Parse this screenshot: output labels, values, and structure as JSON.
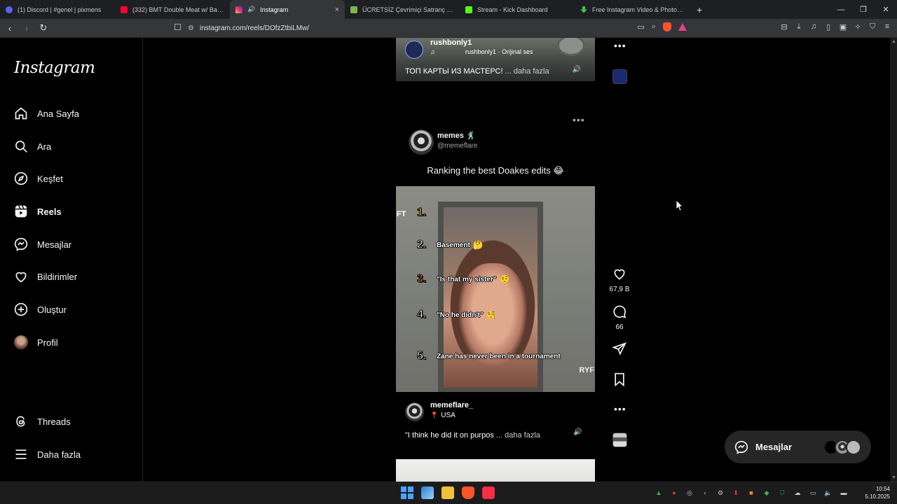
{
  "browser": {
    "tabs": [
      {
        "title": "(1) Discord | #genel | pixmens",
        "color": "#5865f2",
        "active": false
      },
      {
        "title": "(332) BMT Double Meat w/ Bacon - Y",
        "color": "#ff0033",
        "active": false
      },
      {
        "title": "Instagram",
        "color": "#e1306c",
        "active": true,
        "audio": "🔊"
      },
      {
        "title": "ÜCRETSİZ Çevrimiçi Satranç Oynayın",
        "color": "#81b64c",
        "active": false
      },
      {
        "title": "Stream - Kick Dashboard",
        "color": "#53fc18",
        "active": false
      },
      {
        "title": "Free Instagram Video & Photo Down",
        "color": "#3ac24c",
        "active": false
      }
    ],
    "new_tab": "+",
    "tab_close": "×",
    "url": "instagram.com/reels/DOfzZtbiLMw/"
  },
  "sidebar": {
    "logo": "Instagram",
    "items": [
      {
        "label": "Ana Sayfa",
        "icon": "home-icon"
      },
      {
        "label": "Ara",
        "icon": "search-icon"
      },
      {
        "label": "Keşfet",
        "icon": "compass-icon"
      },
      {
        "label": "Reels",
        "icon": "reels-icon",
        "active": true
      },
      {
        "label": "Mesajlar",
        "icon": "messenger-icon"
      },
      {
        "label": "Bildirimler",
        "icon": "heart-icon"
      },
      {
        "label": "Oluştur",
        "icon": "plus-square-icon"
      },
      {
        "label": "Profil",
        "icon": "avatar"
      }
    ],
    "bottom": [
      {
        "label": "Threads",
        "icon": "threads-icon"
      },
      {
        "label": "Daha fazla",
        "icon": "menu-icon"
      }
    ]
  },
  "prev_reel": {
    "username": "rushbonly1",
    "music_note": "♫",
    "audio": "rushbonly1 · Orijinal ses",
    "caption": "ТОП КАРТЫ ИЗ МАСТЕРС!",
    "more": "... daha fazla"
  },
  "post": {
    "username": "memes",
    "username_emoji": "🕺",
    "handle": "@memeflare",
    "caption": "Ranking the best Doakes edits 😂",
    "overlay_left": "FT",
    "overlay_right": "RYF",
    "rankings": [
      {
        "num": "1.",
        "label": "",
        "emoji": "",
        "color": "gold"
      },
      {
        "num": "2.",
        "label": "Basement",
        "emoji": "🤔",
        "color": "white"
      },
      {
        "num": "3.",
        "label": "\"Is that my sister\"",
        "emoji": "🤨",
        "color": "orange"
      },
      {
        "num": "4.",
        "label": "\"No he didn't\"",
        "emoji": "🧐",
        "color": "white"
      },
      {
        "num": "5.",
        "label": "Zane has never been in a tournament",
        "emoji": "",
        "color": "white"
      }
    ]
  },
  "actions": {
    "likes": "67,9 B",
    "comments": "66"
  },
  "next_reel": {
    "username": "memeflare_",
    "location": "USA",
    "caption": "\"I think he did it on purpos",
    "more": "... daha fazla"
  },
  "messages_pill": {
    "label": "Mesajlar"
  },
  "taskbar": {
    "time": "10:54",
    "date": "5.10.2025"
  }
}
